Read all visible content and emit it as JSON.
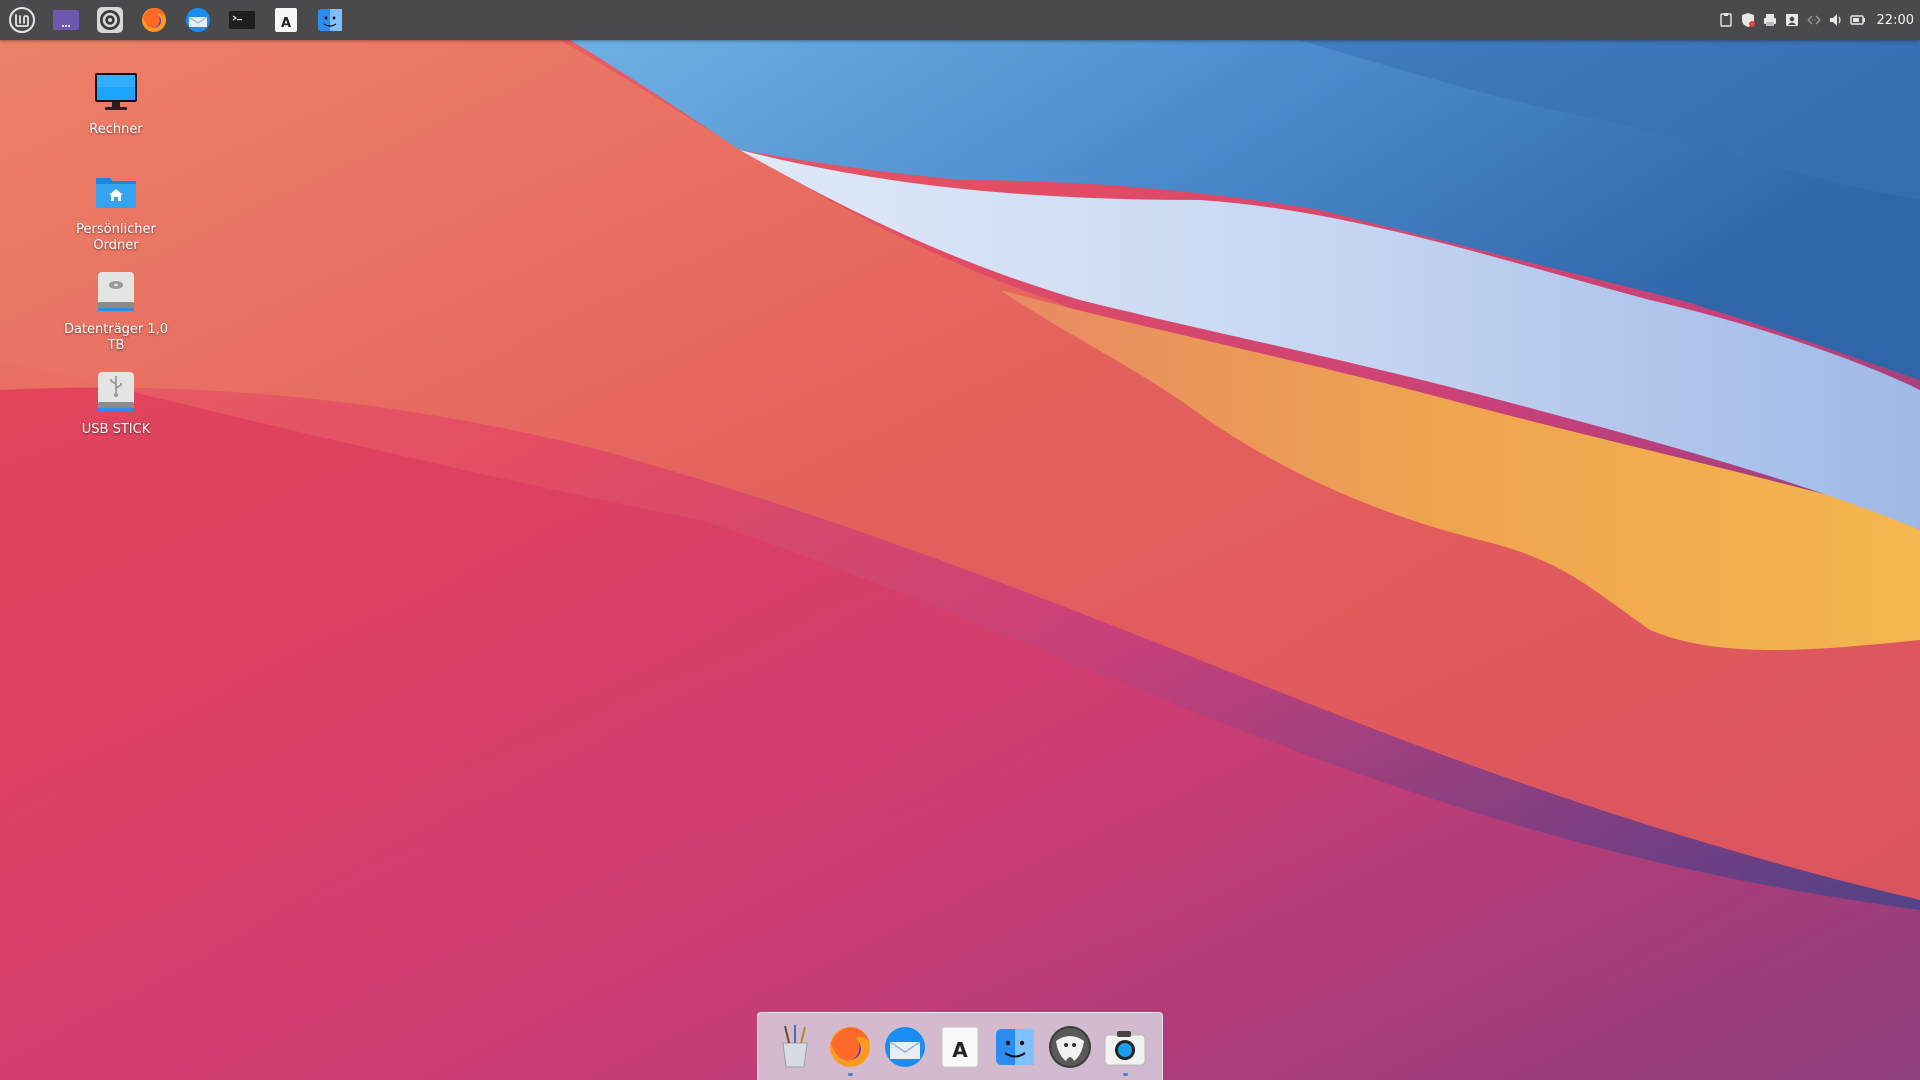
{
  "top_panel": {
    "launchers": [
      {
        "name": "menu-icon"
      },
      {
        "name": "show-desktop-icon"
      },
      {
        "name": "settings-icon"
      },
      {
        "name": "firefox-icon"
      },
      {
        "name": "thunderbird-icon"
      },
      {
        "name": "terminal-icon"
      },
      {
        "name": "text-editor-icon"
      },
      {
        "name": "file-manager-icon"
      }
    ],
    "tray": [
      {
        "name": "clipboard-icon"
      },
      {
        "name": "update-shield-icon"
      },
      {
        "name": "printer-icon"
      },
      {
        "name": "user-icon"
      },
      {
        "name": "network-icon"
      },
      {
        "name": "volume-icon"
      },
      {
        "name": "battery-icon"
      }
    ],
    "clock": "22:00"
  },
  "desktop": {
    "icons": [
      {
        "label": "Rechner",
        "icon": "computer-icon"
      },
      {
        "label": "Persönlicher Ordner",
        "icon": "home-folder-icon"
      },
      {
        "label": "Datenträger 1,0 TB",
        "icon": "hard-disk-icon"
      },
      {
        "label": "USB STICK",
        "icon": "usb-drive-icon"
      }
    ]
  },
  "dock": {
    "items": [
      {
        "name": "paintbrush-app-icon"
      },
      {
        "name": "firefox-icon"
      },
      {
        "name": "thunderbird-icon"
      },
      {
        "name": "text-editor-icon"
      },
      {
        "name": "file-manager-icon"
      },
      {
        "name": "gimp-icon"
      },
      {
        "name": "screenshot-icon"
      }
    ],
    "active_indicators": [
      "firefox-icon",
      "screenshot-icon"
    ]
  },
  "colors": {
    "panel": "#4a4a4c",
    "wallpaper_blue": "#3f7fc2",
    "wallpaper_red": "#e7454f",
    "wallpaper_orange": "#f1a14e",
    "wallpaper_purple": "#6a3e82"
  }
}
